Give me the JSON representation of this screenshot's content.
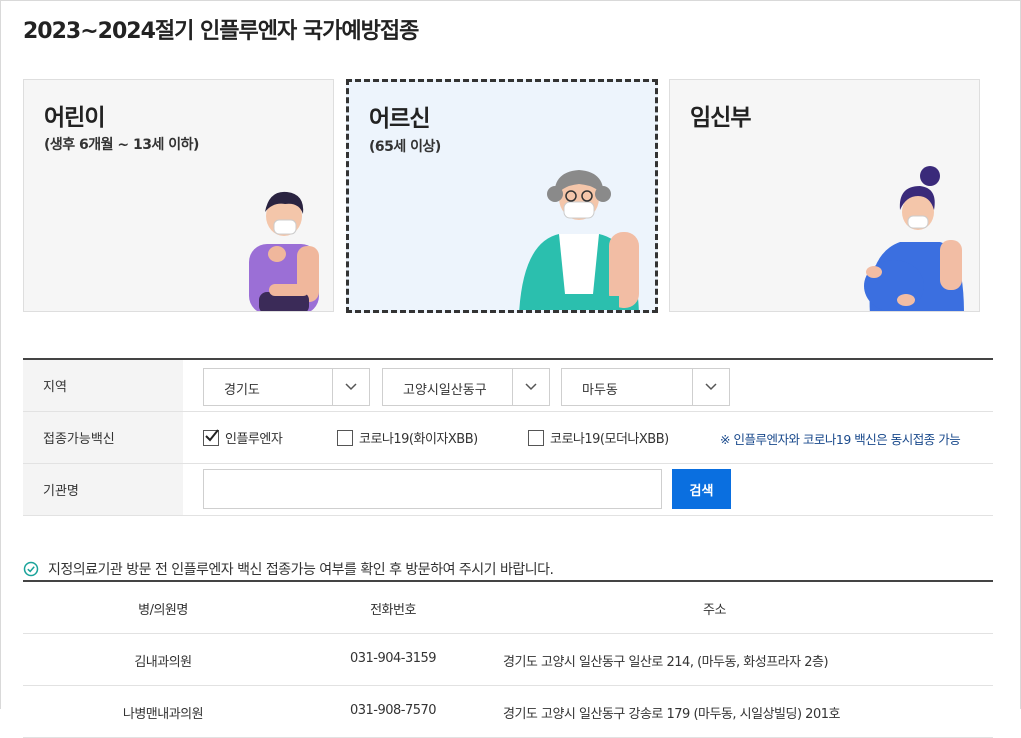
{
  "page_title": "2023~2024절기 인플루엔자 국가예방접종",
  "cards": [
    {
      "title": "어린이",
      "subtitle": "(생후 6개월 ~ 13세 이하)",
      "selected": false
    },
    {
      "title": "어르신",
      "subtitle": "(65세 이상)",
      "selected": true
    },
    {
      "title": "임신부",
      "subtitle": "",
      "selected": false
    }
  ],
  "form": {
    "region_label": "지역",
    "region_selects": [
      "경기도",
      "고양시일산동구",
      "마두동"
    ],
    "vaccine_label": "접종가능백신",
    "vaccines": [
      {
        "label": "인플루엔자",
        "checked": true
      },
      {
        "label": "코로나19(화이자XBB)",
        "checked": false
      },
      {
        "label": "코로나19(모더나XBB)",
        "checked": false
      }
    ],
    "vaccine_note": "※ 인플루엔자와 코로나19 백신은 동시접종 가능",
    "institution_label": "기관명",
    "institution_value": "",
    "search_button": "검색"
  },
  "notice": "지정의료기관 방문 전 인플루엔자 백신 접종가능 여부를 확인 후 방문하여 주시기 바랍니다.",
  "table": {
    "headers": [
      "병/의원명",
      "전화번호",
      "주소"
    ],
    "rows": [
      [
        "김내과의원",
        "031-904-3159",
        "경기도 고양시 일산동구 일산로 214, (마두동, 화성프라자 2층)"
      ],
      [
        "나병맨내과의원",
        "031-908-7570",
        "경기도 고양시 일산동구 강송로 179 (마두동, 시일상빌딩) 201호"
      ]
    ]
  },
  "colors": {
    "accent": "#0a6fe0",
    "note": "#1a4a8c",
    "selected_card_bg": "#edf4fc"
  }
}
